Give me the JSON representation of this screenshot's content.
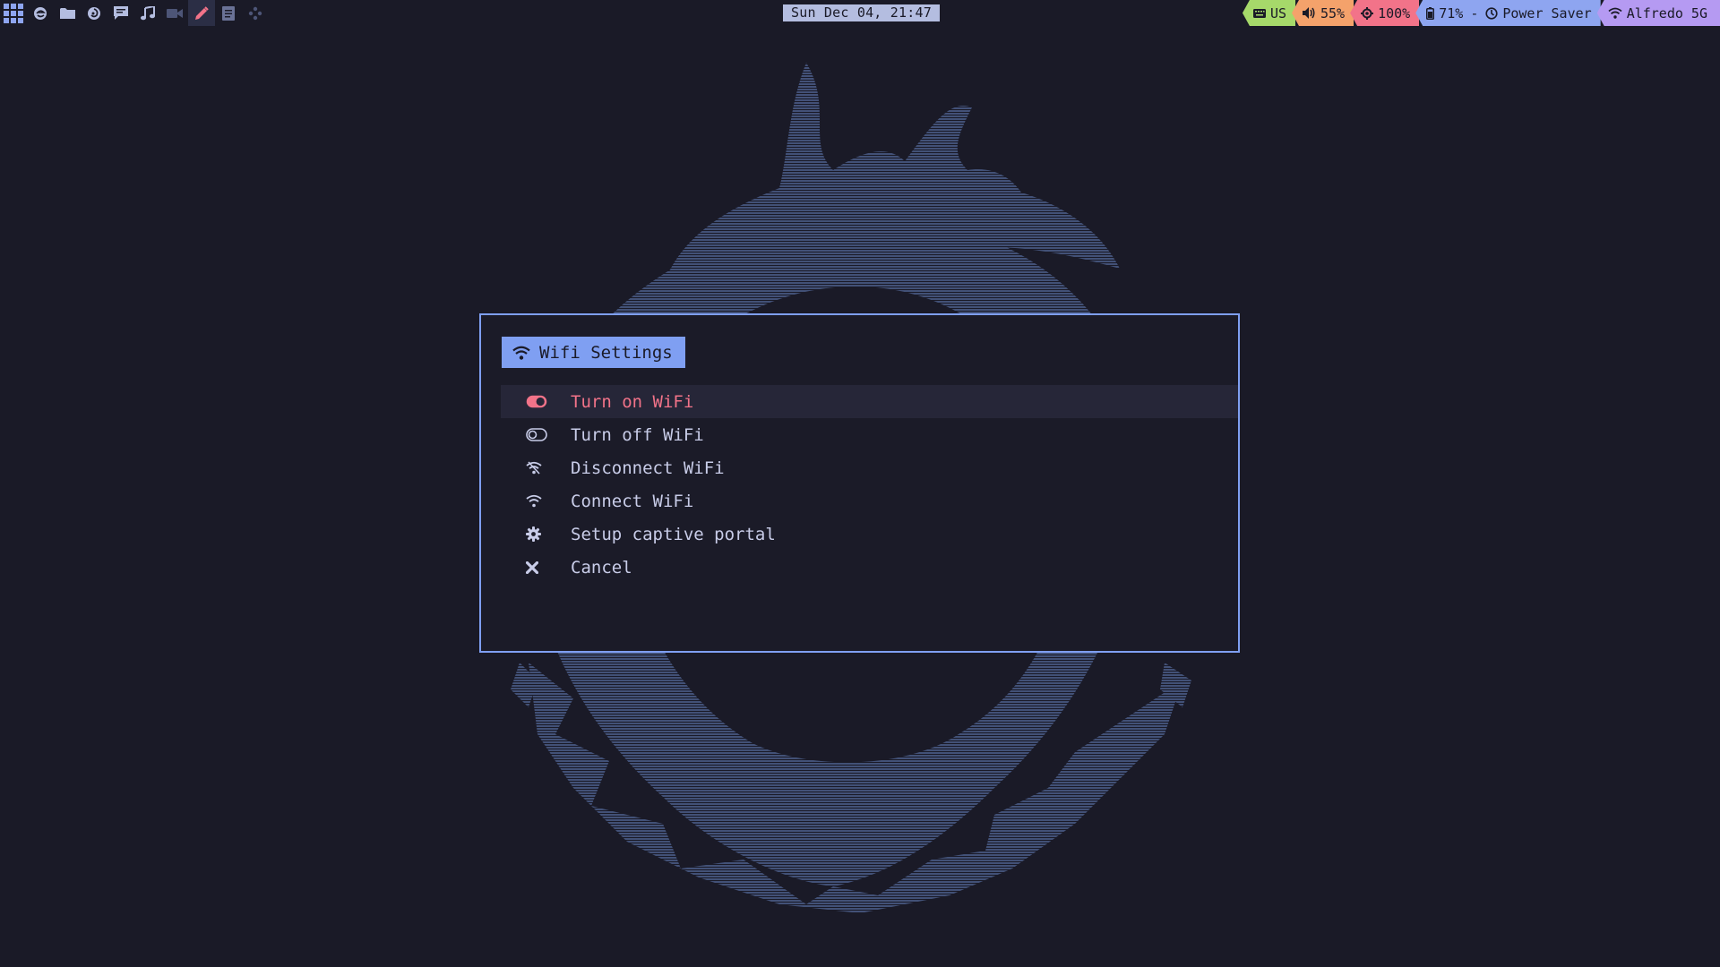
{
  "topbar": {
    "workspaces": [
      {
        "icon": "apps-grid-icon",
        "active": false
      },
      {
        "icon": "browser-icon",
        "active": false
      },
      {
        "icon": "folder-icon",
        "active": false
      },
      {
        "icon": "firefox-icon",
        "active": false
      },
      {
        "icon": "chat-icon",
        "active": false
      },
      {
        "icon": "music-note-icon",
        "active": false
      },
      {
        "icon": "video-camera-icon",
        "active": false
      },
      {
        "icon": "pencil-icon",
        "active": true
      },
      {
        "icon": "document-icon",
        "active": false
      },
      {
        "icon": "gamepad-icon",
        "active": false
      }
    ],
    "clock": "Sun Dec 04, 21:47",
    "status": {
      "keyboard_layout": "US",
      "volume": "55%",
      "brightness": "100%",
      "battery": "71%",
      "battery_separator": "-",
      "power_profile": "Power Saver",
      "wifi_network": "Alfredo 5G"
    },
    "colors": {
      "keyboard": "#a6d96a",
      "volume": "#f4a26b",
      "brightness": "#f27389",
      "battery": "#8ea5f0",
      "wifi": "#b59af2"
    }
  },
  "dialog": {
    "title": "Wifi Settings",
    "title_icon": "wifi-icon",
    "accent_color": "#7f9ff2",
    "selected_color": "#f27389",
    "items": [
      {
        "label": "Turn on WiFi",
        "icon": "toggle-on-icon",
        "selected": true
      },
      {
        "label": "Turn off WiFi",
        "icon": "toggle-off-icon",
        "selected": false
      },
      {
        "label": "Disconnect WiFi",
        "icon": "wifi-off-icon",
        "selected": false
      },
      {
        "label": "Connect WiFi",
        "icon": "wifi-icon",
        "selected": false
      },
      {
        "label": "Setup captive portal",
        "icon": "gear-icon",
        "selected": false
      },
      {
        "label": "Cancel",
        "icon": "close-icon",
        "selected": false
      }
    ]
  }
}
